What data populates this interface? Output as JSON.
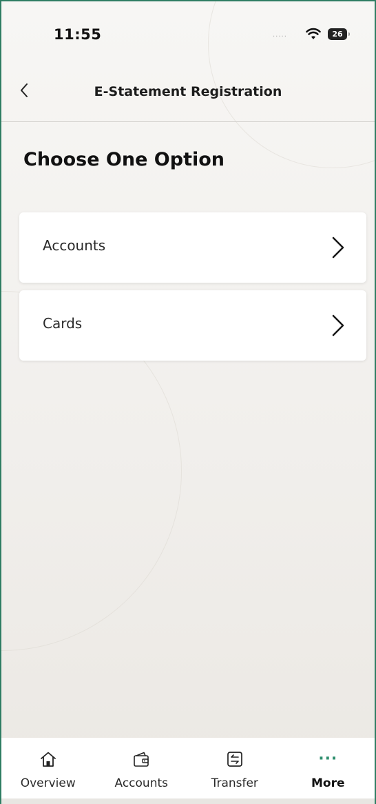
{
  "status_bar": {
    "time": "11:55",
    "signal": ".....",
    "battery": "26"
  },
  "header": {
    "title": "E-Statement Registration"
  },
  "main": {
    "heading": "Choose One Option",
    "options": [
      {
        "label": "Accounts"
      },
      {
        "label": "Cards"
      }
    ]
  },
  "tab_bar": {
    "items": [
      {
        "label": "Overview",
        "icon": "home-icon"
      },
      {
        "label": "Accounts",
        "icon": "wallet-icon"
      },
      {
        "label": "Transfer",
        "icon": "transfer-icon"
      },
      {
        "label": "More",
        "icon": "more-icon",
        "active": true
      }
    ]
  },
  "colors": {
    "accent": "#2f8f6e",
    "frame": "#2f7d63"
  }
}
